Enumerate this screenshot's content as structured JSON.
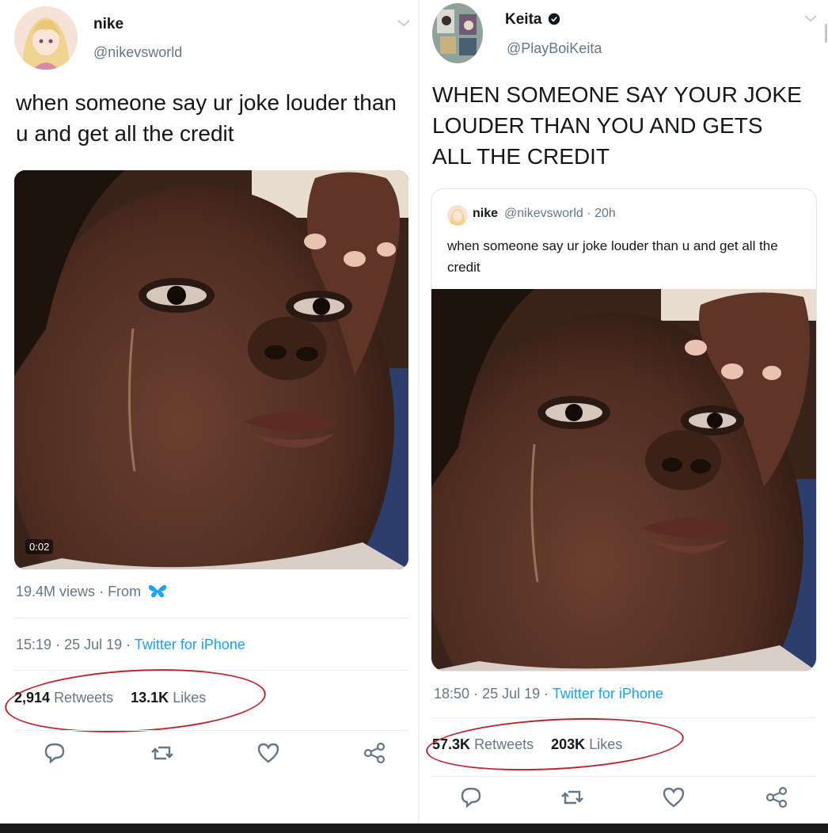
{
  "left_tweet": {
    "author_name": "nike",
    "author_handle": "@nikevsworld",
    "text": "when someone say ur joke louder than u and get all the credit",
    "video_duration": "0:02",
    "views": "19.4M views",
    "from_label": "From",
    "time": "15:19",
    "date": "25 Jul 19",
    "source": "Twitter for iPhone",
    "retweets_count": "2,914",
    "retweets_label": "Retweets",
    "likes_count": "13.1K",
    "likes_label": "Likes"
  },
  "right_tweet": {
    "author_name": "Keita",
    "author_handle": "@PlayBoiKeita",
    "text": "WHEN SOMEONE SAY YOUR JOKE LOUDER THAN YOU AND GETS ALL THE CREDIT",
    "quoted": {
      "author_name": "nike",
      "author_handle": "@nikevsworld",
      "age": "20h",
      "text": "when someone say ur joke louder than u and get all the credit"
    },
    "time": "18:50",
    "date": "25 Jul 19",
    "source": "Twitter for iPhone",
    "retweets_count": "57.3K",
    "retweets_label": "Retweets",
    "likes_count": "203K",
    "likes_label": "Likes"
  },
  "icons": [
    "reply-icon",
    "retweet-icon",
    "like-icon",
    "share-icon",
    "verified-icon",
    "butterfly-icon",
    "chevron-down-icon"
  ],
  "colors": {
    "link_blue": "#1da1f2",
    "secondary_text": "#657786",
    "annotation_red": "#b5272d"
  }
}
